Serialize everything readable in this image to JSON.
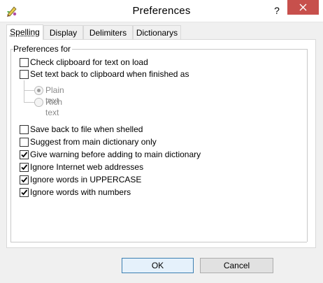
{
  "window": {
    "title": "Preferences",
    "help_label": "?"
  },
  "tabs": [
    {
      "label": "Spelling",
      "active": true
    },
    {
      "label": "Display",
      "active": false
    },
    {
      "label": "Delimiters",
      "active": false
    },
    {
      "label": "Dictionarys",
      "active": false
    }
  ],
  "group": {
    "label": "Preferences for"
  },
  "options": {
    "check_clipboard": {
      "label": "Check clipboard for text on load",
      "checked": false
    },
    "set_text_back": {
      "label": "Set text back to clipboard when finished as",
      "checked": false
    },
    "plain_text": {
      "label": "Plain text",
      "selected": true,
      "enabled": false
    },
    "rich_text": {
      "label": "Rich text",
      "selected": false,
      "enabled": false
    },
    "save_back": {
      "label": "Save back to file when shelled",
      "checked": false
    },
    "suggest_main": {
      "label": "Suggest from main dictionary only",
      "checked": false
    },
    "give_warning": {
      "label": "Give warning before adding to main dictionary",
      "checked": true
    },
    "ignore_web": {
      "label": "Ignore Internet web addresses",
      "checked": true
    },
    "ignore_upper": {
      "label": "Ignore words in UPPERCASE",
      "checked": true
    },
    "ignore_numbers": {
      "label": "Ignore words with numbers",
      "checked": true
    }
  },
  "buttons": {
    "ok": "OK",
    "cancel": "Cancel"
  },
  "colors": {
    "close_button": "#c7504c",
    "default_button_border": "#3c7fb1"
  }
}
